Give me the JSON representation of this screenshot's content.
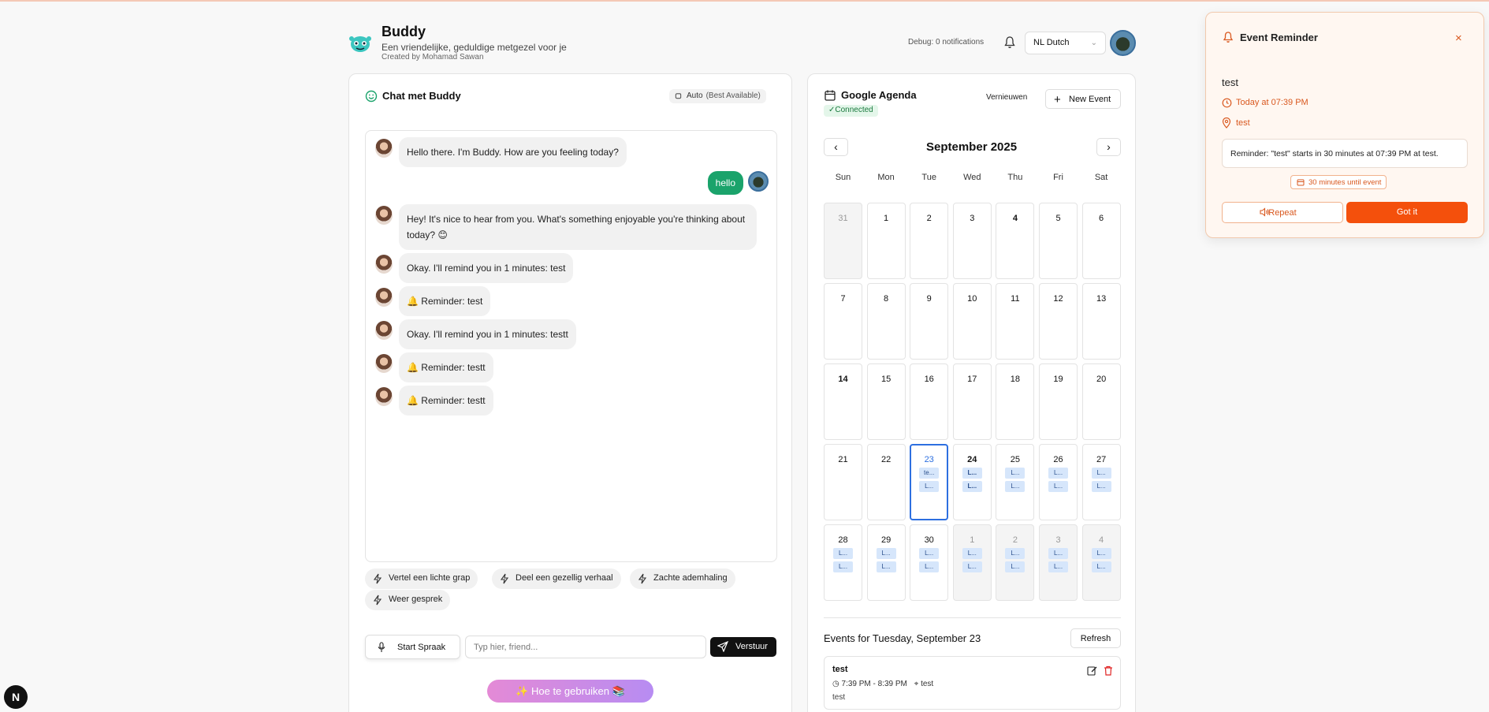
{
  "header": {
    "title": "Buddy",
    "subtitle": "Een vriendelijke, geduldige metgezel voor je",
    "created_by": "Created by Mohamad Sawan",
    "debug": "Debug: 0 notifications",
    "language": "NL Dutch"
  },
  "chat": {
    "title": "Chat met Buddy",
    "model_label": "Auto",
    "model_hint": "(Best Available)",
    "messages": [
      {
        "from": "bot",
        "text": "Hello there. I'm Buddy. How are you feeling today?"
      },
      {
        "from": "user",
        "text": "hello"
      },
      {
        "from": "bot",
        "text": "Hey! It's nice to hear from you. What's something enjoyable you're thinking about today? 😊"
      },
      {
        "from": "bot",
        "text": "Okay. I'll remind you in 1 minutes: test"
      },
      {
        "from": "bot",
        "text": "🔔 Reminder: test"
      },
      {
        "from": "bot",
        "text": "Okay. I'll remind you in 1 minutes: testt"
      },
      {
        "from": "bot",
        "text": "🔔 Reminder: testt"
      },
      {
        "from": "bot",
        "text": "🔔 Reminder: testt"
      }
    ],
    "suggestions": [
      "Vertel een lichte grap",
      "Deel een gezellig verhaal",
      "Zachte ademhaling",
      "Weer gesprek"
    ],
    "voice_label": "Start Spraak",
    "input_placeholder": "Typ hier, friend...",
    "send_label": "Verstuur",
    "howto_label": "✨ Hoe te gebruiken 📚"
  },
  "calendar": {
    "title": "Google Agenda",
    "status": "✓Connected",
    "refresh_label": "Vernieuwen",
    "new_event_label": "New Event",
    "month": "September 2025",
    "weekdays": [
      "Sun",
      "Mon",
      "Tue",
      "Wed",
      "Thu",
      "Fri",
      "Sat"
    ],
    "weeks": [
      [
        {
          "d": "31",
          "other": true
        },
        {
          "d": "1"
        },
        {
          "d": "2"
        },
        {
          "d": "3"
        },
        {
          "d": "4",
          "bold": true
        },
        {
          "d": "5"
        },
        {
          "d": "6"
        }
      ],
      [
        {
          "d": "7"
        },
        {
          "d": "8"
        },
        {
          "d": "9"
        },
        {
          "d": "10"
        },
        {
          "d": "11"
        },
        {
          "d": "12"
        },
        {
          "d": "13"
        }
      ],
      [
        {
          "d": "14",
          "bold": true
        },
        {
          "d": "15"
        },
        {
          "d": "16"
        },
        {
          "d": "17"
        },
        {
          "d": "18"
        },
        {
          "d": "19"
        },
        {
          "d": "20"
        }
      ],
      [
        {
          "d": "21"
        },
        {
          "d": "22"
        },
        {
          "d": "23",
          "today": true,
          "events": [
            "te...",
            "L..."
          ]
        },
        {
          "d": "24",
          "bold": true,
          "events": [
            "L...",
            "L..."
          ]
        },
        {
          "d": "25",
          "events": [
            "L...",
            "L..."
          ]
        },
        {
          "d": "26",
          "events": [
            "L...",
            "L..."
          ]
        },
        {
          "d": "27",
          "events": [
            "L...",
            "L..."
          ]
        }
      ],
      [
        {
          "d": "28",
          "events": [
            "L...",
            "L..."
          ]
        },
        {
          "d": "29",
          "events": [
            "L...",
            "L..."
          ]
        },
        {
          "d": "30",
          "events": [
            "L...",
            "L..."
          ]
        },
        {
          "d": "1",
          "other": true,
          "events": [
            "L...",
            "L..."
          ]
        },
        {
          "d": "2",
          "other": true,
          "events": [
            "L...",
            "L..."
          ]
        },
        {
          "d": "3",
          "other": true,
          "events": [
            "L...",
            "L..."
          ]
        },
        {
          "d": "4",
          "other": true,
          "events": [
            "L...",
            "L..."
          ]
        }
      ]
    ],
    "events_title": "Events for Tuesday, September 23",
    "events_refresh": "Refresh",
    "event": {
      "title": "test",
      "time": "7:39 PM - 8:39 PM",
      "location": "test",
      "note": "test"
    }
  },
  "reminder": {
    "title": "Event Reminder",
    "close": "×",
    "event_name": "test",
    "time": "Today at 07:39 PM",
    "location": "test",
    "message": "Reminder: \"test\" starts in 30 minutes at 07:39 PM at test.",
    "countdown": "30 minutes until event",
    "repeat_label": "Repeat",
    "got_it_label": "Got it"
  },
  "colors": {
    "accent_green": "#1aa36b",
    "reminder_orange": "#f4500c",
    "today_blue": "#2d6fe0"
  }
}
